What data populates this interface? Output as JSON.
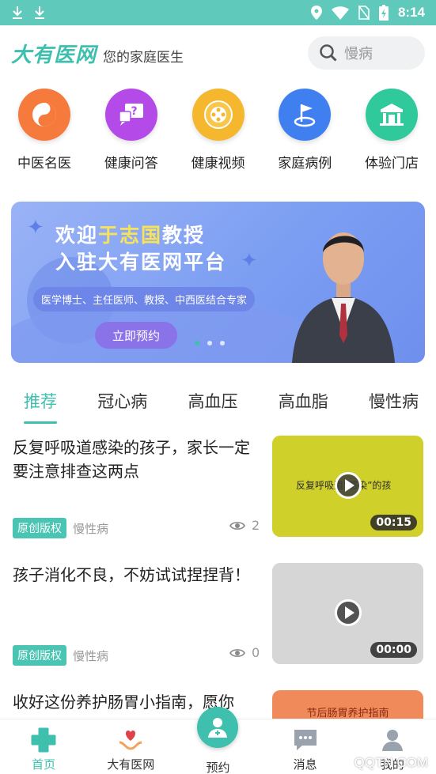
{
  "status_bar": {
    "time": "8:14",
    "left_icons": [
      "download-icon",
      "download-icon"
    ],
    "right_icons": [
      "location-icon",
      "wifi-icon",
      "no-sim-icon",
      "battery-charging-icon"
    ]
  },
  "header": {
    "logo": "大有医网",
    "tagline": "您的家庭医生",
    "search_placeholder": "慢病",
    "search_icon": "search-icon"
  },
  "categories": [
    {
      "label": "中医名医",
      "icon": "yin-yang-icon",
      "color": "#f57a3c"
    },
    {
      "label": "健康问答",
      "icon": "question-chat-icon",
      "color": "#b44be8"
    },
    {
      "label": "健康视频",
      "icon": "film-reel-icon",
      "color": "#f4b72e"
    },
    {
      "label": "家庭病例",
      "icon": "flag-pin-icon",
      "color": "#3f7ff0"
    },
    {
      "label": "体验门店",
      "icon": "storefront-icon",
      "color": "#2fc99b"
    }
  ],
  "banner": {
    "title_prefix": "欢迎",
    "title_name": "于志国",
    "title_suffix": "教授",
    "title_line2": "入驻大有医网平台",
    "subtitle": "医学博士、主任医师、教授、中西医结合专家",
    "button": "立即预约",
    "slide_count": 3,
    "active_slide": 1
  },
  "tabs": [
    {
      "label": "推荐",
      "active": true
    },
    {
      "label": "冠心病",
      "active": false
    },
    {
      "label": "高血压",
      "active": false
    },
    {
      "label": "高血脂",
      "active": false
    },
    {
      "label": "慢性病",
      "active": false
    }
  ],
  "articles": [
    {
      "title": "反复呼吸道感染的孩子，家长一定要注意排查这两点",
      "badge": "原创版权",
      "category": "慢性病",
      "views": "2",
      "duration": "00:15",
      "thumb_caption": "反复呼吸道“感染”的孩",
      "thumb_color": "#cfd12a"
    },
    {
      "title": "孩子消化不良，不妨试试捏捏背！",
      "badge": "原创版权",
      "category": "慢性病",
      "views": "0",
      "duration": "00:00",
      "thumb_caption": "",
      "thumb_color": "#d6d6d6"
    },
    {
      "title": "收好这份养护肠胃小指南，愿你",
      "thumb_caption": "节后肠胃养护指南",
      "thumb_color": "#f08a5a"
    }
  ],
  "bottom_nav": [
    {
      "label": "首页",
      "icon": "medical-cross-icon",
      "active": true
    },
    {
      "label": "大有医网",
      "icon": "heart-hands-icon",
      "active": false
    },
    {
      "label": "预约",
      "icon": "doctor-icon",
      "active": false
    },
    {
      "label": "消息",
      "icon": "message-icon",
      "active": false
    },
    {
      "label": "我的",
      "icon": "user-icon",
      "active": false
    }
  ],
  "watermark": "QQTN.COM"
}
